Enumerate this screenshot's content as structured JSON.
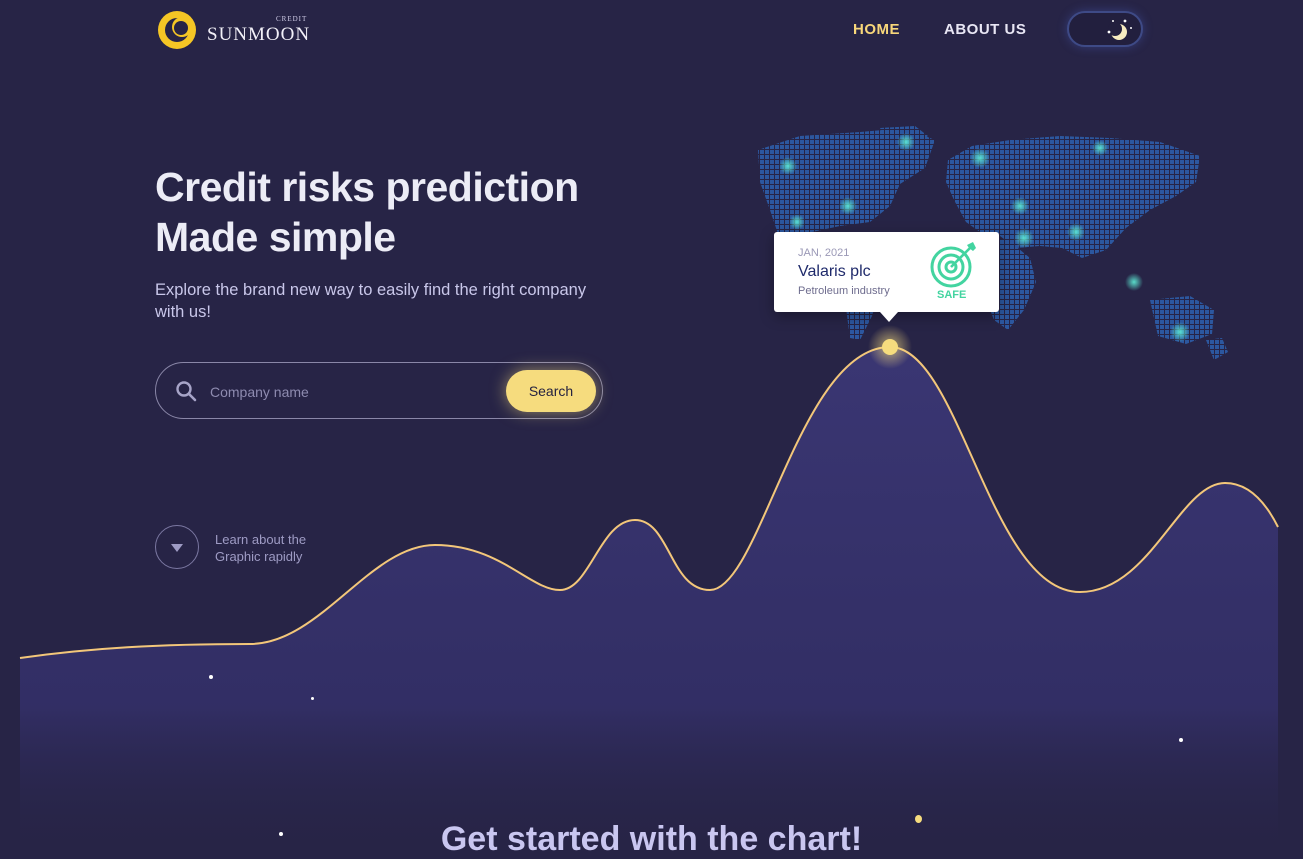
{
  "brand": {
    "name": "SUNMOON",
    "tagline": "CREDIT"
  },
  "nav": {
    "home": "HOME",
    "about": "ABOUT US"
  },
  "hero": {
    "title_line1": "Credit risks prediction",
    "title_line2": "Made simple",
    "subtitle": "Explore the brand new way to easily find the right company with us!"
  },
  "search": {
    "placeholder": "Company name",
    "button_label": "Search"
  },
  "learn": {
    "text": "Learn about the Graphic rapidly"
  },
  "tooltip": {
    "date": "JAN, 2021",
    "company": "Valaris plc",
    "industry": "Petroleum industry",
    "status": "SAFE"
  },
  "section": {
    "title": "Get started with the chart!"
  },
  "colors": {
    "background": "#272446",
    "accent": "#f6dc7e",
    "safe": "#43d4a0",
    "map": "#2f6fc4"
  },
  "icons": {
    "logo": "crescent-logo-icon",
    "theme": "moon-stars-icon",
    "search": "search-icon",
    "learn": "chevron-down-icon",
    "status": "target-icon"
  }
}
